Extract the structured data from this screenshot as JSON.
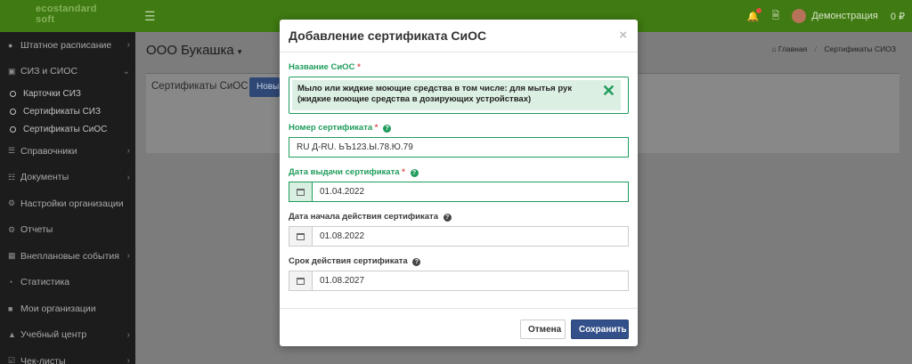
{
  "topbar": {
    "logo_line1": "ecostandard",
    "logo_line2": "soft",
    "user_name": "Демонстрация",
    "balance": "0 ₽"
  },
  "sidebar": {
    "items": [
      {
        "label": "Штатное расписание",
        "icon": "users-icon",
        "has_arrow": true
      },
      {
        "label": "СИЗ и СИОС",
        "icon": "briefcase-icon",
        "has_arrow": true
      },
      {
        "label": "Справочники",
        "icon": "list-icon",
        "has_arrow": true
      },
      {
        "label": "Документы",
        "icon": "columns-icon",
        "has_arrow": true
      },
      {
        "label": "Настройки организации",
        "icon": "gear-icon",
        "has_arrow": false
      },
      {
        "label": "Отчеты",
        "icon": "gear-icon",
        "has_arrow": false
      },
      {
        "label": "Внеплановые события",
        "icon": "calendar-icon",
        "has_arrow": true
      },
      {
        "label": "Статистика",
        "icon": "pie-chart-icon",
        "has_arrow": false
      },
      {
        "label": "Мои организации",
        "icon": "building-icon",
        "has_arrow": false
      },
      {
        "label": "Учебный центр",
        "icon": "graduation-cap-icon",
        "has_arrow": true
      },
      {
        "label": "Чек-листы",
        "icon": "checklist-icon",
        "has_arrow": true
      }
    ],
    "sub_items": [
      "Карточки СИЗ",
      "Сертификаты СИЗ",
      "Сертификаты СиОС"
    ]
  },
  "content": {
    "org_title": "ООО Букашка",
    "breadcrumb_home": "Главная",
    "breadcrumb_current": "Сертификаты СИОЗ",
    "panel_title": "Сертификаты СиОС",
    "new_button": "Новы"
  },
  "modal": {
    "title": "Добавление сертификата СиОС",
    "close": "×",
    "name_label": "Название СиОС",
    "name_value": "Мыло или жидкие моющие средства в том числе: для мытья рук (жидкие моющие средства в дозирующих устройствах)",
    "number_label": "Номер сертификата",
    "number_value": "RU Д-RU. ЬЪ123.Ы.78.Ю.79",
    "issue_label": "Дата выдачи сертификата",
    "issue_value": "01.04.2022",
    "start_label": "Дата начала действия сертификата",
    "start_value": "01.08.2022",
    "expiry_label": "Срок действия сертификата",
    "expiry_value": "01.08.2027",
    "required_mark": "*",
    "help_mark": "?",
    "cancel_label": "Отмена",
    "save_label": "Сохранить"
  },
  "colors": {
    "topbar": "#3f7a12",
    "sidebar": "#1c1c1c",
    "accent_green": "#1e9c5b",
    "primary_button": "#34508a"
  }
}
